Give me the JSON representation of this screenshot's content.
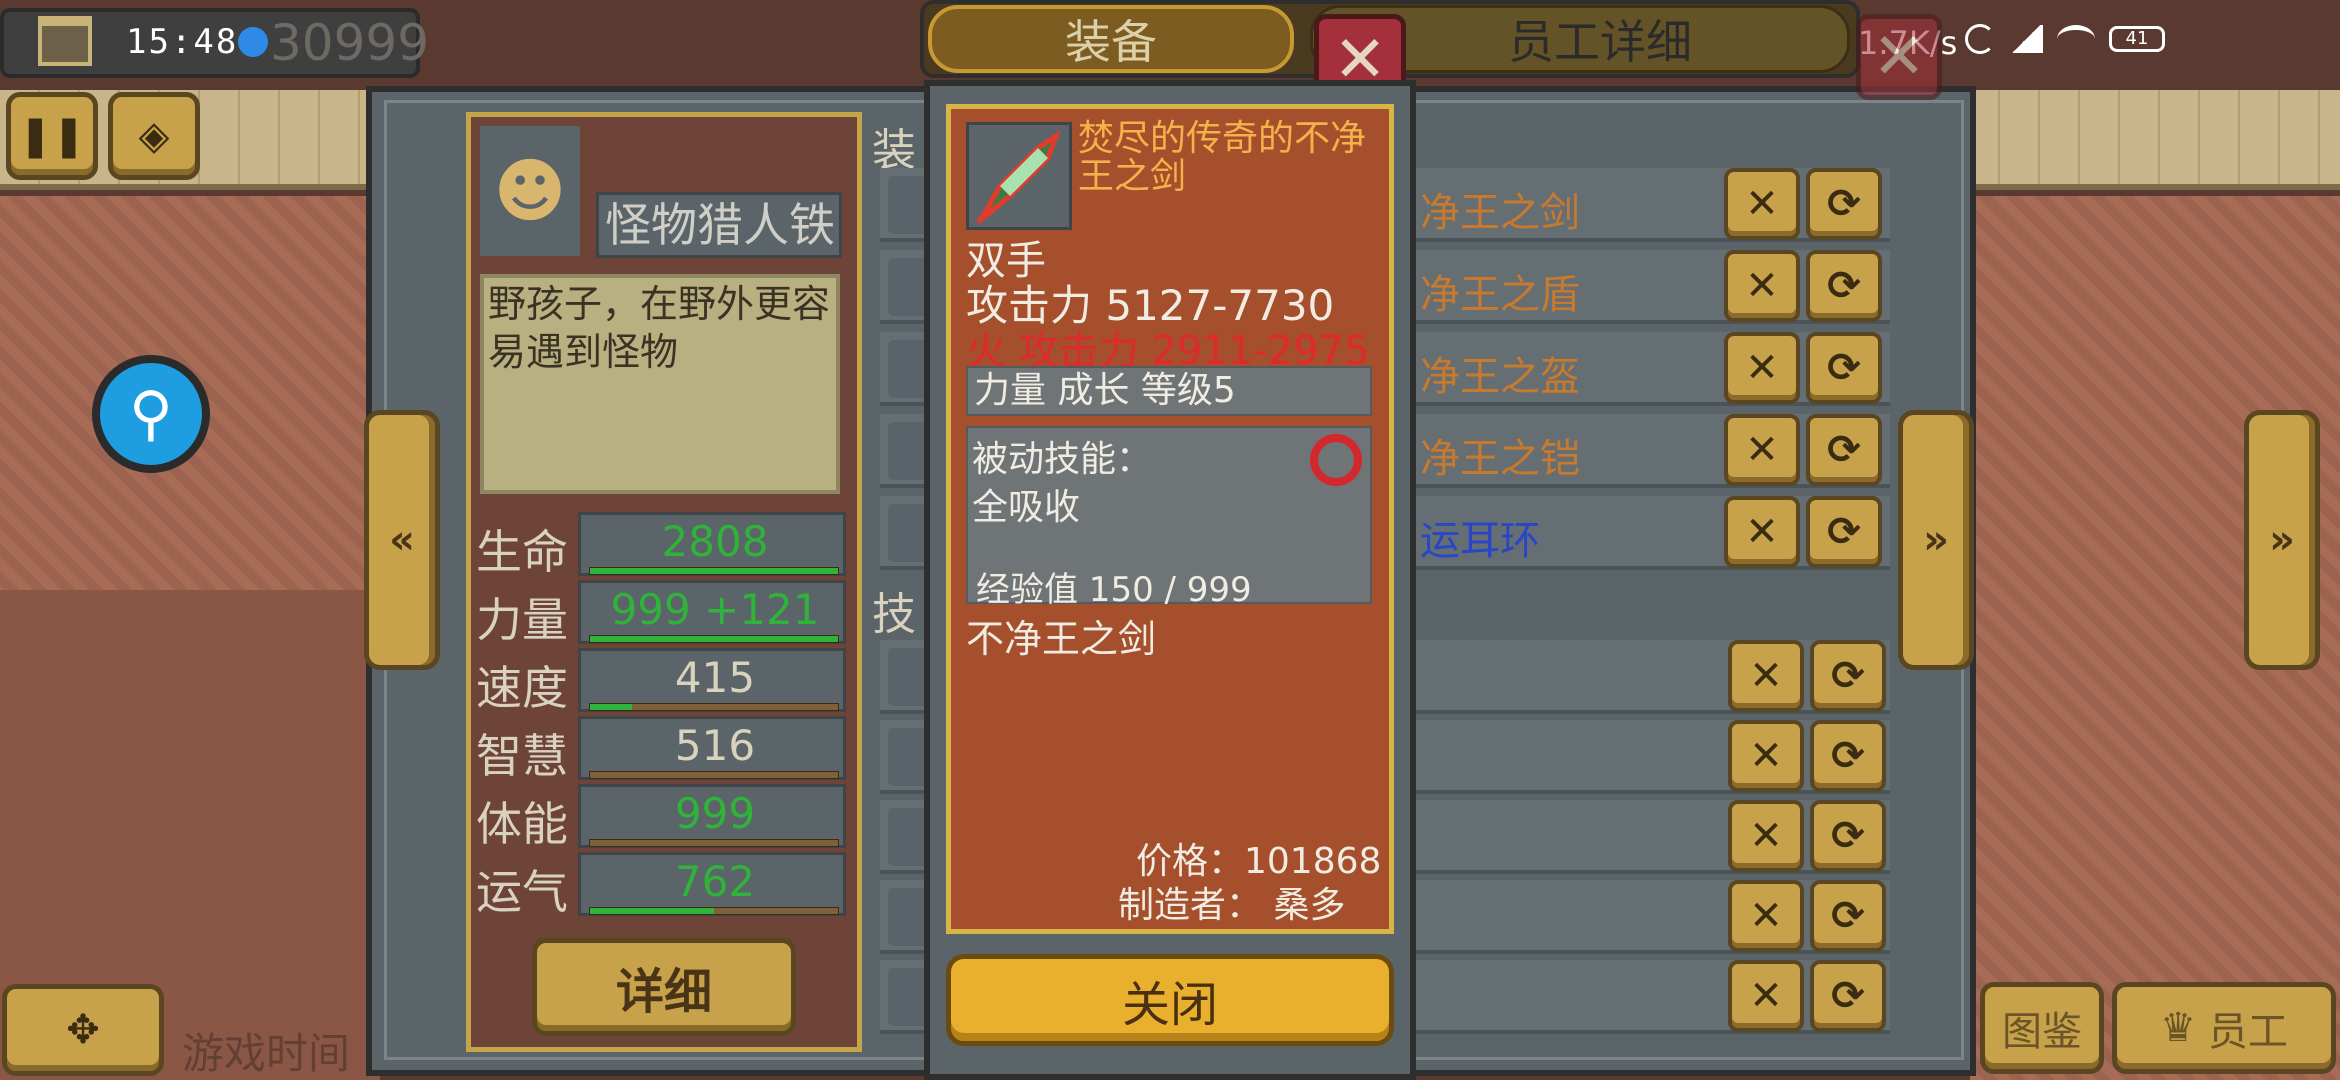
{
  "status_bar": {
    "time": "15:48",
    "money": "30999",
    "net_speed": "1.7K/s",
    "battery": "41",
    "icons": [
      "building-icon",
      "app-badge-icon",
      "moon-icon",
      "signal-icon",
      "wifi-icon",
      "battery-icon"
    ]
  },
  "tabs": {
    "equipment": "装备",
    "staff_detail": "员工详细"
  },
  "character": {
    "name": "怪物猎人铁",
    "description": "野孩子，在野外更容易遇到怪物",
    "stats": [
      {
        "label": "生命",
        "value": "2808",
        "color": "#2fb338",
        "bar": 1.0
      },
      {
        "label": "力量",
        "value": "999 +121",
        "color": "#2fb338",
        "bar": 1.0
      },
      {
        "label": "速度",
        "value": "415",
        "color": "#d9d2bf",
        "bar": 0.17
      },
      {
        "label": "智慧",
        "value": "516",
        "color": "#d9d2bf",
        "bar": 0.0
      },
      {
        "label": "体能",
        "value": "999",
        "color": "#2fb338",
        "bar": 0.0
      },
      {
        "label": "运气",
        "value": "762",
        "color": "#2fb338",
        "bar": 0.5
      }
    ],
    "detail_button": "详细"
  },
  "middle": {
    "equip_header": "装",
    "skill_header": "技",
    "equipment_rows": [
      {
        "name": "净王之剑",
        "color": "#c77a2e"
      },
      {
        "name": "净王之盾",
        "color": "#c77a2e"
      },
      {
        "name": "净王之盔",
        "color": "#c77a2e"
      },
      {
        "name": "净王之铠",
        "color": "#c77a2e"
      },
      {
        "name": "运耳环",
        "color": "#2a46c8"
      }
    ]
  },
  "item_popup": {
    "title": "焚尽的传奇的不净王之剑",
    "hand": "双手",
    "attack": "攻击力  5127-7730",
    "fire_attack": "火  攻击力  2911-2975",
    "growth": "力量  成长  等级5",
    "passive_label": "被动技能：",
    "passive_skill": "全吸收",
    "exp": "经验值  150  /  999",
    "base_name": "不净王之剑",
    "price": "价格：101868",
    "maker": "制造者：  桑多",
    "close_button": "关闭"
  },
  "bottom_bar": {
    "game_time": "游戏时间",
    "catalog": "图鉴",
    "staff": "员工"
  },
  "colors": {
    "gold_button": "#c7a24b",
    "panel_grey": "#5b6469",
    "card_brown": "#a54f2c",
    "close_red": "#a3303a"
  }
}
